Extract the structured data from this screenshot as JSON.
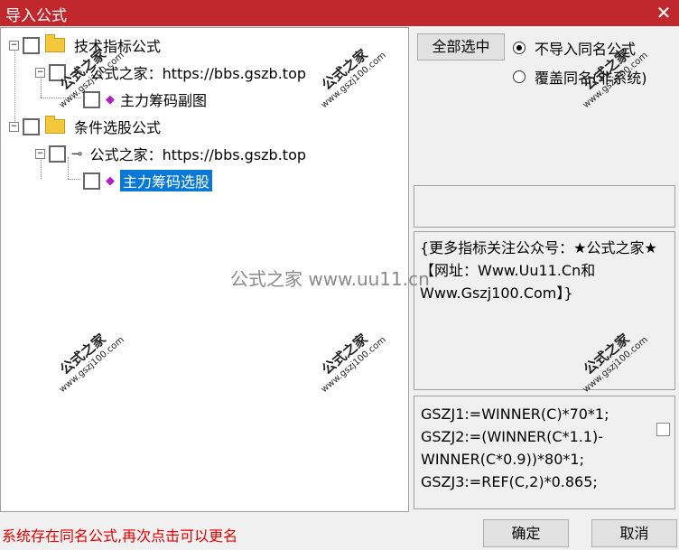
{
  "window": {
    "title": "导入公式",
    "close_glyph": "✕"
  },
  "tree": {
    "groups": [
      {
        "label": "技术指标公式",
        "source": "公式之家：https://bbs.gszb.top",
        "formula": "主力筹码副图"
      },
      {
        "label": "条件选股公式",
        "source": "公式之家：https://bbs.gszb.top",
        "formula": "主力筹码选股"
      }
    ],
    "expand_glyph": "−",
    "selected_item": "主力筹码选股"
  },
  "options": {
    "select_all_label": "全部选中",
    "radios": [
      {
        "label": "不导入同名公式",
        "selected": true
      },
      {
        "label": "覆盖同名(非系统)",
        "selected": false
      }
    ]
  },
  "description": "{更多指标关注公众号：★公式之家★ 【网址：Www.Uu11.Cn和Www.Gszj100.Com】}",
  "code_lines": [
    "GSZJ1:=WINNER(C)*70*1;",
    "GSZJ2:=(WINNER(C*1.1)-",
    "WINNER(C*0.9))*80*1;",
    "GSZJ3:=REF(C,2)*0.865;"
  ],
  "status_text": "系统存在同名公式,再次点击可以更名",
  "buttons": {
    "ok": "确定",
    "cancel": "取消"
  },
  "watermark": {
    "center_text": "公式之家 www.uu11.cn",
    "stamp_title": "公式之家",
    "stamp_url": "www.gszj100.com"
  },
  "colors": {
    "title_bar": "#c0282e",
    "selection": "#0a78d7",
    "status_text": "#e00000"
  }
}
